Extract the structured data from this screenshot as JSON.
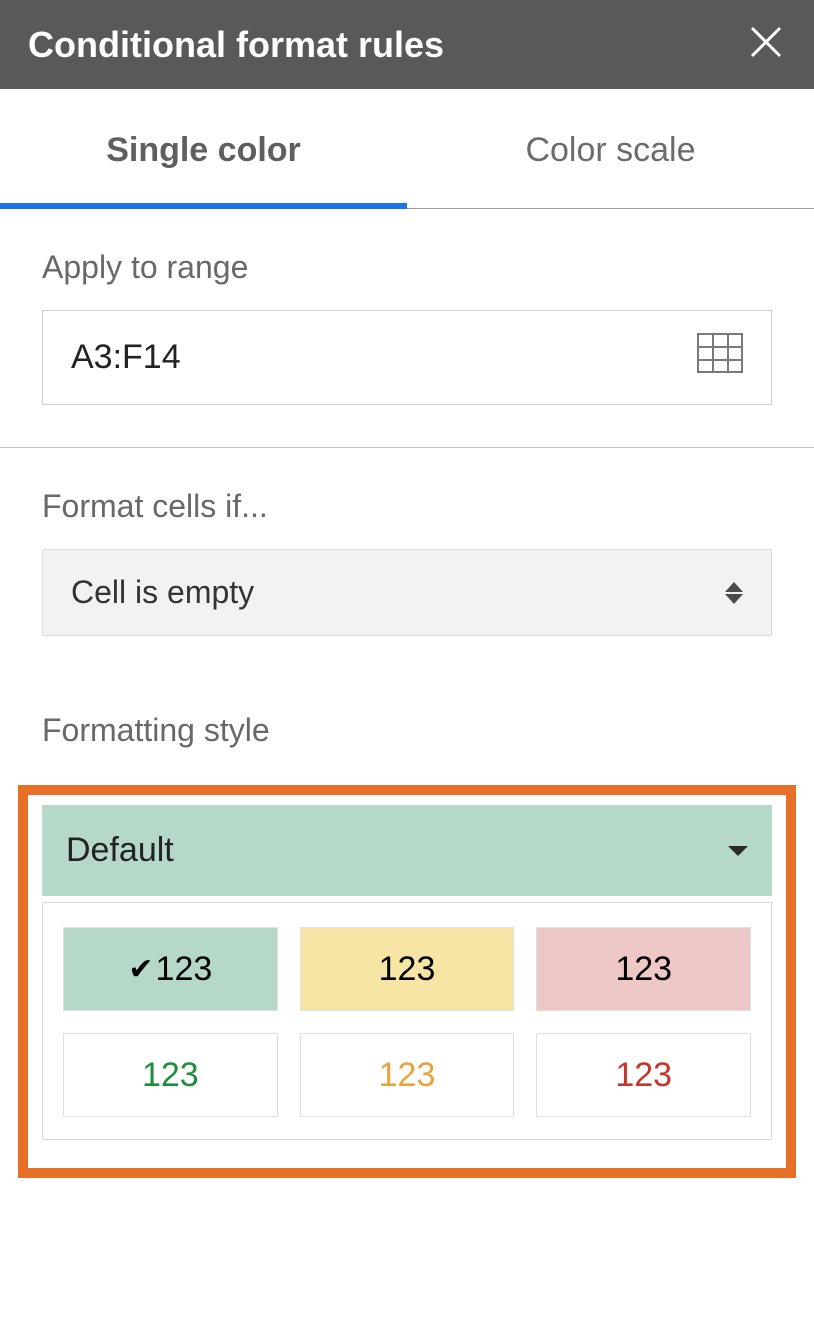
{
  "header": {
    "title": "Conditional format rules"
  },
  "tabs": {
    "single": "Single color",
    "scale": "Color scale"
  },
  "range": {
    "label": "Apply to range",
    "value": "A3:F14"
  },
  "condition": {
    "label": "Format cells if...",
    "value": "Cell is empty"
  },
  "style": {
    "label": "Formatting style",
    "default": "Default",
    "swatch_text": "123"
  }
}
